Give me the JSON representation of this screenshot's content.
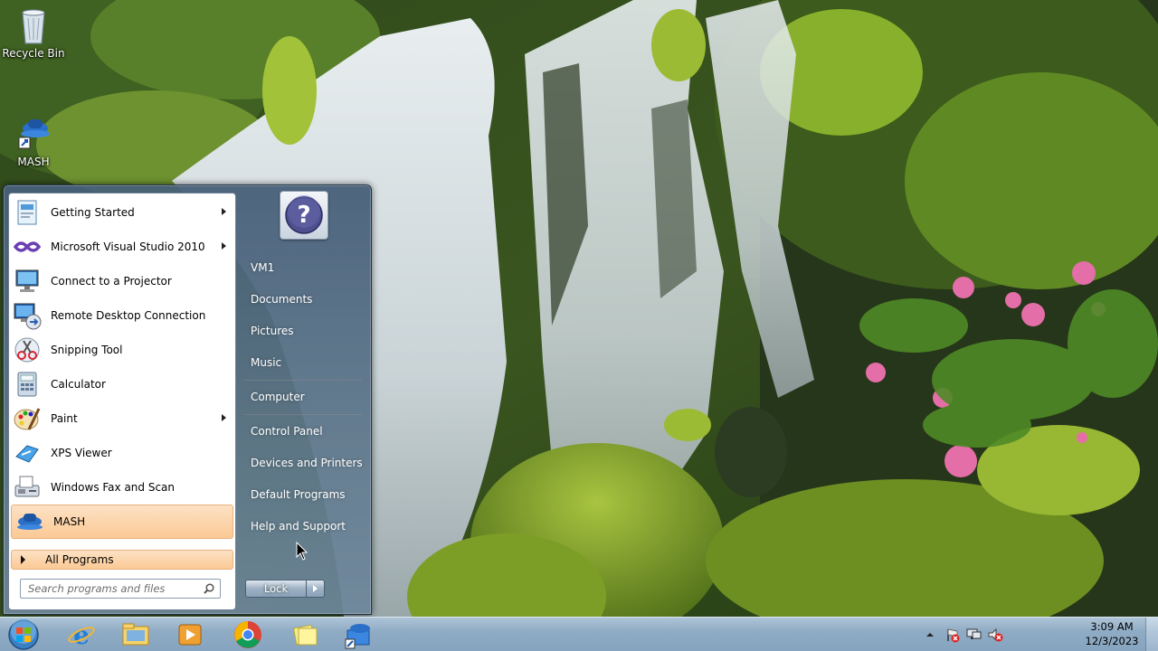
{
  "desktop": {
    "icons": [
      {
        "label": "Recycle Bin",
        "icon": "recycle-bin-icon"
      },
      {
        "label": "MASH",
        "icon": "mash-shortcut-icon"
      }
    ]
  },
  "start_menu": {
    "programs": [
      {
        "label": "Getting Started",
        "icon": "getting-started-icon",
        "has_submenu": true
      },
      {
        "label": "Microsoft Visual Studio 2010",
        "icon": "visual-studio-icon",
        "has_submenu": true
      },
      {
        "label": "Connect to a Projector",
        "icon": "projector-icon",
        "has_submenu": false
      },
      {
        "label": "Remote Desktop Connection",
        "icon": "remote-desktop-icon",
        "has_submenu": false
      },
      {
        "label": "Snipping Tool",
        "icon": "snipping-tool-icon",
        "has_submenu": false
      },
      {
        "label": "Calculator",
        "icon": "calculator-icon",
        "has_submenu": false
      },
      {
        "label": "Paint",
        "icon": "paint-icon",
        "has_submenu": true
      },
      {
        "label": "XPS Viewer",
        "icon": "xps-viewer-icon",
        "has_submenu": false
      },
      {
        "label": "Windows Fax and Scan",
        "icon": "fax-scan-icon",
        "has_submenu": false
      },
      {
        "label": "MASH",
        "icon": "mash-icon",
        "has_submenu": false,
        "highlighted": true
      }
    ],
    "all_programs": "All Programs",
    "search_placeholder": "Search programs and files",
    "right_links": [
      {
        "label": "VM1"
      },
      {
        "label": "Documents"
      },
      {
        "label": "Pictures"
      },
      {
        "label": "Music"
      },
      {
        "label": "Computer"
      },
      {
        "label": "Control Panel"
      },
      {
        "label": "Devices and Printers"
      },
      {
        "label": "Default Programs"
      },
      {
        "label": "Help and Support"
      }
    ],
    "lock_label": "Lock"
  },
  "taskbar": {
    "pinned": [
      {
        "name": "internet-explorer-icon"
      },
      {
        "name": "windows-explorer-icon"
      },
      {
        "name": "media-player-icon"
      },
      {
        "name": "chrome-icon"
      },
      {
        "name": "sticky-notes-icon"
      },
      {
        "name": "mash-taskbar-icon"
      }
    ],
    "clock_time": "3:09 AM",
    "clock_date": "12/3/2023"
  },
  "colors": {
    "menu_highlight": "#fbc995",
    "taskbar": "#96b2ce"
  }
}
